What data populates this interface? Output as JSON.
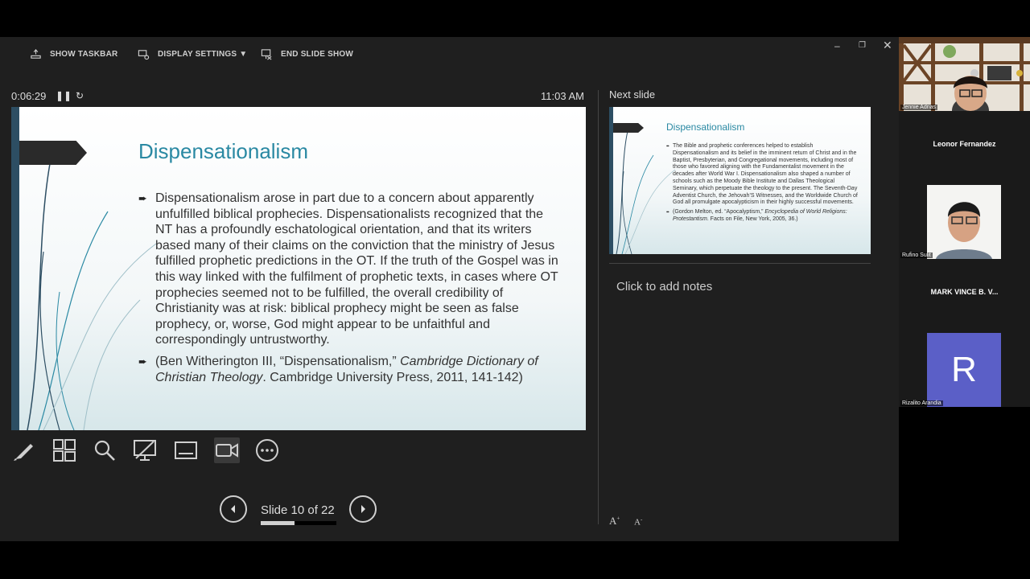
{
  "toolbar": {
    "show_taskbar": "SHOW TASKBAR",
    "display_settings": "DISPLAY SETTINGS ▼",
    "end_slide_show": "END SLIDE SHOW"
  },
  "status": {
    "timer": "0:06:29",
    "clock": "11:03 AM",
    "next_slide_label": "Next slide"
  },
  "current_slide": {
    "title": "Dispensationalism",
    "bullet_1": "Dispensationalism arose in part due to a concern about apparently unfulfilled biblical prophecies. Dispensationalists recognized that the NT has a profoundly eschatological orientation, and that its writers based many of their claims on the conviction that the ministry of Jesus fulfilled prophetic predictions in the OT. If the truth of the Gospel was in this way linked with the fulfilment of prophetic texts, in cases where OT prophecies seemed not to be fulfilled, the overall credibility of Christianity was at risk: biblical prophecy might be seen as false prophecy, or, worse, God might appear to be unfaithful and correspondingly untrustworthy.",
    "bullet_2_pre": "(Ben Witherington III, “Dispensationalism,” ",
    "bullet_2_italic": "Cambridge Dictionary of Christian Theology",
    "bullet_2_post": ". Cambridge University Press, 2011, 141-142)"
  },
  "navigation": {
    "slide_counter": "Slide 10 of 22",
    "progress_fraction": 0.45
  },
  "next_slide": {
    "title": "Dispensationalism",
    "bullet_1": "The Bible and prophetic conferences helped to establish Dispensationalism and its belief in the imminent return of Christ and in the Baptist, Presbyterian, and Congregational movements, including most of those who favored aligning with the Fundamentalist movement in the decades after World War I. Dispensationalism also shaped a number of schools such as the Moody Bible Institute and Dallas Theological Seminary, which perpetuate the theology to the present. The Seventh-Day Adventist Church, the Jehovah’S Witnesses, and the Worldwide Church of God all promulgate apocalypticism in their highly successful movements.",
    "bullet_2_pre": "(Gordon Melton, ed. “Apocalyptism,” ",
    "bullet_2_italic": "Encyclopedia of World Religions: Protestantism",
    "bullet_2_post": ". Facts on File, New York, 2005, 36.)"
  },
  "notes": {
    "placeholder": "Click to add notes"
  },
  "participants": [
    {
      "name": "Jennie Adrias",
      "video": true
    },
    {
      "name": "Leonor Fernandez",
      "video": false
    },
    {
      "name": "Rufino Sulit",
      "video": true
    },
    {
      "name": "MARK VINCE B. V...",
      "video": false
    },
    {
      "name": "Rizalito Arandia",
      "avatar_letter": "R"
    }
  ]
}
